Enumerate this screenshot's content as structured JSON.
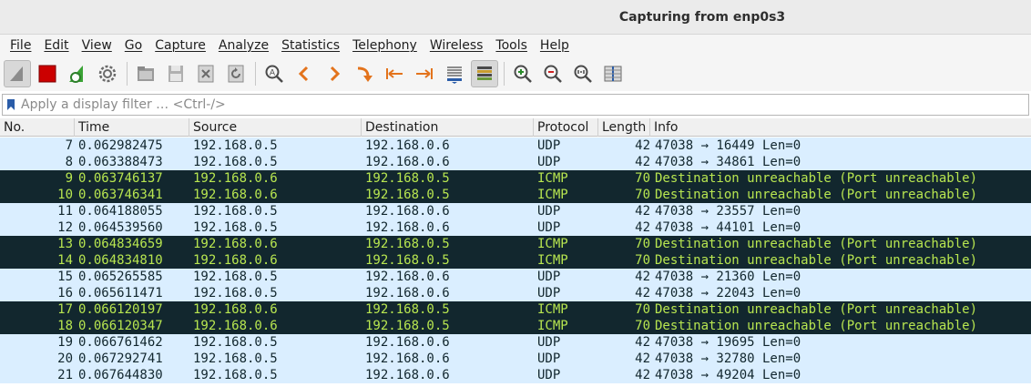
{
  "window": {
    "title": "Capturing from enp0s3"
  },
  "menu": [
    "File",
    "Edit",
    "View",
    "Go",
    "Capture",
    "Analyze",
    "Statistics",
    "Telephony",
    "Wireless",
    "Tools",
    "Help"
  ],
  "filter": {
    "placeholder": "Apply a display filter … <Ctrl-/>"
  },
  "columns": {
    "no": "No.",
    "time": "Time",
    "source": "Source",
    "destination": "Destination",
    "protocol": "Protocol",
    "length": "Length",
    "info": "Info"
  },
  "colors": {
    "udp_bg": "#daeeff",
    "udp_fg": "#12272e",
    "icmp_bg": "#12272e",
    "icmp_fg": "#b8e650",
    "stop_red": "#cc0000"
  },
  "packets": [
    {
      "no": "7",
      "time": "0.062982475",
      "source": "192.168.0.5",
      "destination": "192.168.0.6",
      "protocol": "UDP",
      "length": "42",
      "info": "47038 → 16449 Len=0"
    },
    {
      "no": "8",
      "time": "0.063388473",
      "source": "192.168.0.5",
      "destination": "192.168.0.6",
      "protocol": "UDP",
      "length": "42",
      "info": "47038 → 34861 Len=0"
    },
    {
      "no": "9",
      "time": "0.063746137",
      "source": "192.168.0.6",
      "destination": "192.168.0.5",
      "protocol": "ICMP",
      "length": "70",
      "info": "Destination unreachable (Port unreachable)"
    },
    {
      "no": "10",
      "time": "0.063746341",
      "source": "192.168.0.6",
      "destination": "192.168.0.5",
      "protocol": "ICMP",
      "length": "70",
      "info": "Destination unreachable (Port unreachable)"
    },
    {
      "no": "11",
      "time": "0.064188055",
      "source": "192.168.0.5",
      "destination": "192.168.0.6",
      "protocol": "UDP",
      "length": "42",
      "info": "47038 → 23557 Len=0"
    },
    {
      "no": "12",
      "time": "0.064539560",
      "source": "192.168.0.5",
      "destination": "192.168.0.6",
      "protocol": "UDP",
      "length": "42",
      "info": "47038 → 44101 Len=0"
    },
    {
      "no": "13",
      "time": "0.064834659",
      "source": "192.168.0.6",
      "destination": "192.168.0.5",
      "protocol": "ICMP",
      "length": "70",
      "info": "Destination unreachable (Port unreachable)"
    },
    {
      "no": "14",
      "time": "0.064834810",
      "source": "192.168.0.6",
      "destination": "192.168.0.5",
      "protocol": "ICMP",
      "length": "70",
      "info": "Destination unreachable (Port unreachable)"
    },
    {
      "no": "15",
      "time": "0.065265585",
      "source": "192.168.0.5",
      "destination": "192.168.0.6",
      "protocol": "UDP",
      "length": "42",
      "info": "47038 → 21360 Len=0"
    },
    {
      "no": "16",
      "time": "0.065611471",
      "source": "192.168.0.5",
      "destination": "192.168.0.6",
      "protocol": "UDP",
      "length": "42",
      "info": "47038 → 22043 Len=0"
    },
    {
      "no": "17",
      "time": "0.066120197",
      "source": "192.168.0.6",
      "destination": "192.168.0.5",
      "protocol": "ICMP",
      "length": "70",
      "info": "Destination unreachable (Port unreachable)"
    },
    {
      "no": "18",
      "time": "0.066120347",
      "source": "192.168.0.6",
      "destination": "192.168.0.5",
      "protocol": "ICMP",
      "length": "70",
      "info": "Destination unreachable (Port unreachable)"
    },
    {
      "no": "19",
      "time": "0.066761462",
      "source": "192.168.0.5",
      "destination": "192.168.0.6",
      "protocol": "UDP",
      "length": "42",
      "info": "47038 → 19695 Len=0"
    },
    {
      "no": "20",
      "time": "0.067292741",
      "source": "192.168.0.5",
      "destination": "192.168.0.6",
      "protocol": "UDP",
      "length": "42",
      "info": "47038 → 32780 Len=0"
    },
    {
      "no": "21",
      "time": "0.067644830",
      "source": "192.168.0.5",
      "destination": "192.168.0.6",
      "protocol": "UDP",
      "length": "42",
      "info": "47038 → 49204 Len=0"
    }
  ]
}
